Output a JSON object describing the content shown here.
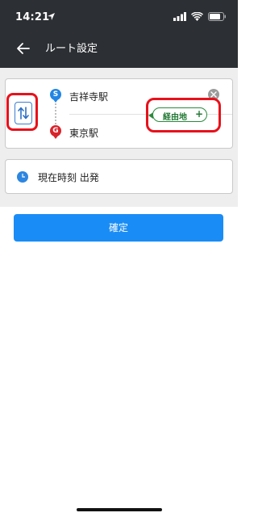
{
  "status_bar": {
    "time": "14:21",
    "icons": [
      "location-arrow-icon",
      "cellular-signal-icon",
      "wifi-icon",
      "battery-icon"
    ]
  },
  "header": {
    "title": "ルート設定",
    "back_icon": "back-arrow-icon"
  },
  "route": {
    "start": {
      "badge": "S",
      "name": "吉祥寺駅",
      "color": "#2285e4"
    },
    "goal": {
      "badge": "G",
      "name": "東京駅",
      "color": "#d9232b"
    },
    "swap_icon": "swap-arrows-icon",
    "clear_icon": "clear-icon",
    "via_button": {
      "label": "経由地",
      "plus": "+",
      "color": "#2a8a3d"
    }
  },
  "departure": {
    "icon": "clock-icon",
    "label": "現在時刻 出発"
  },
  "confirm_button": {
    "label": "確定",
    "color": "#1a8cf6"
  },
  "annotation_color": "#e8111b"
}
